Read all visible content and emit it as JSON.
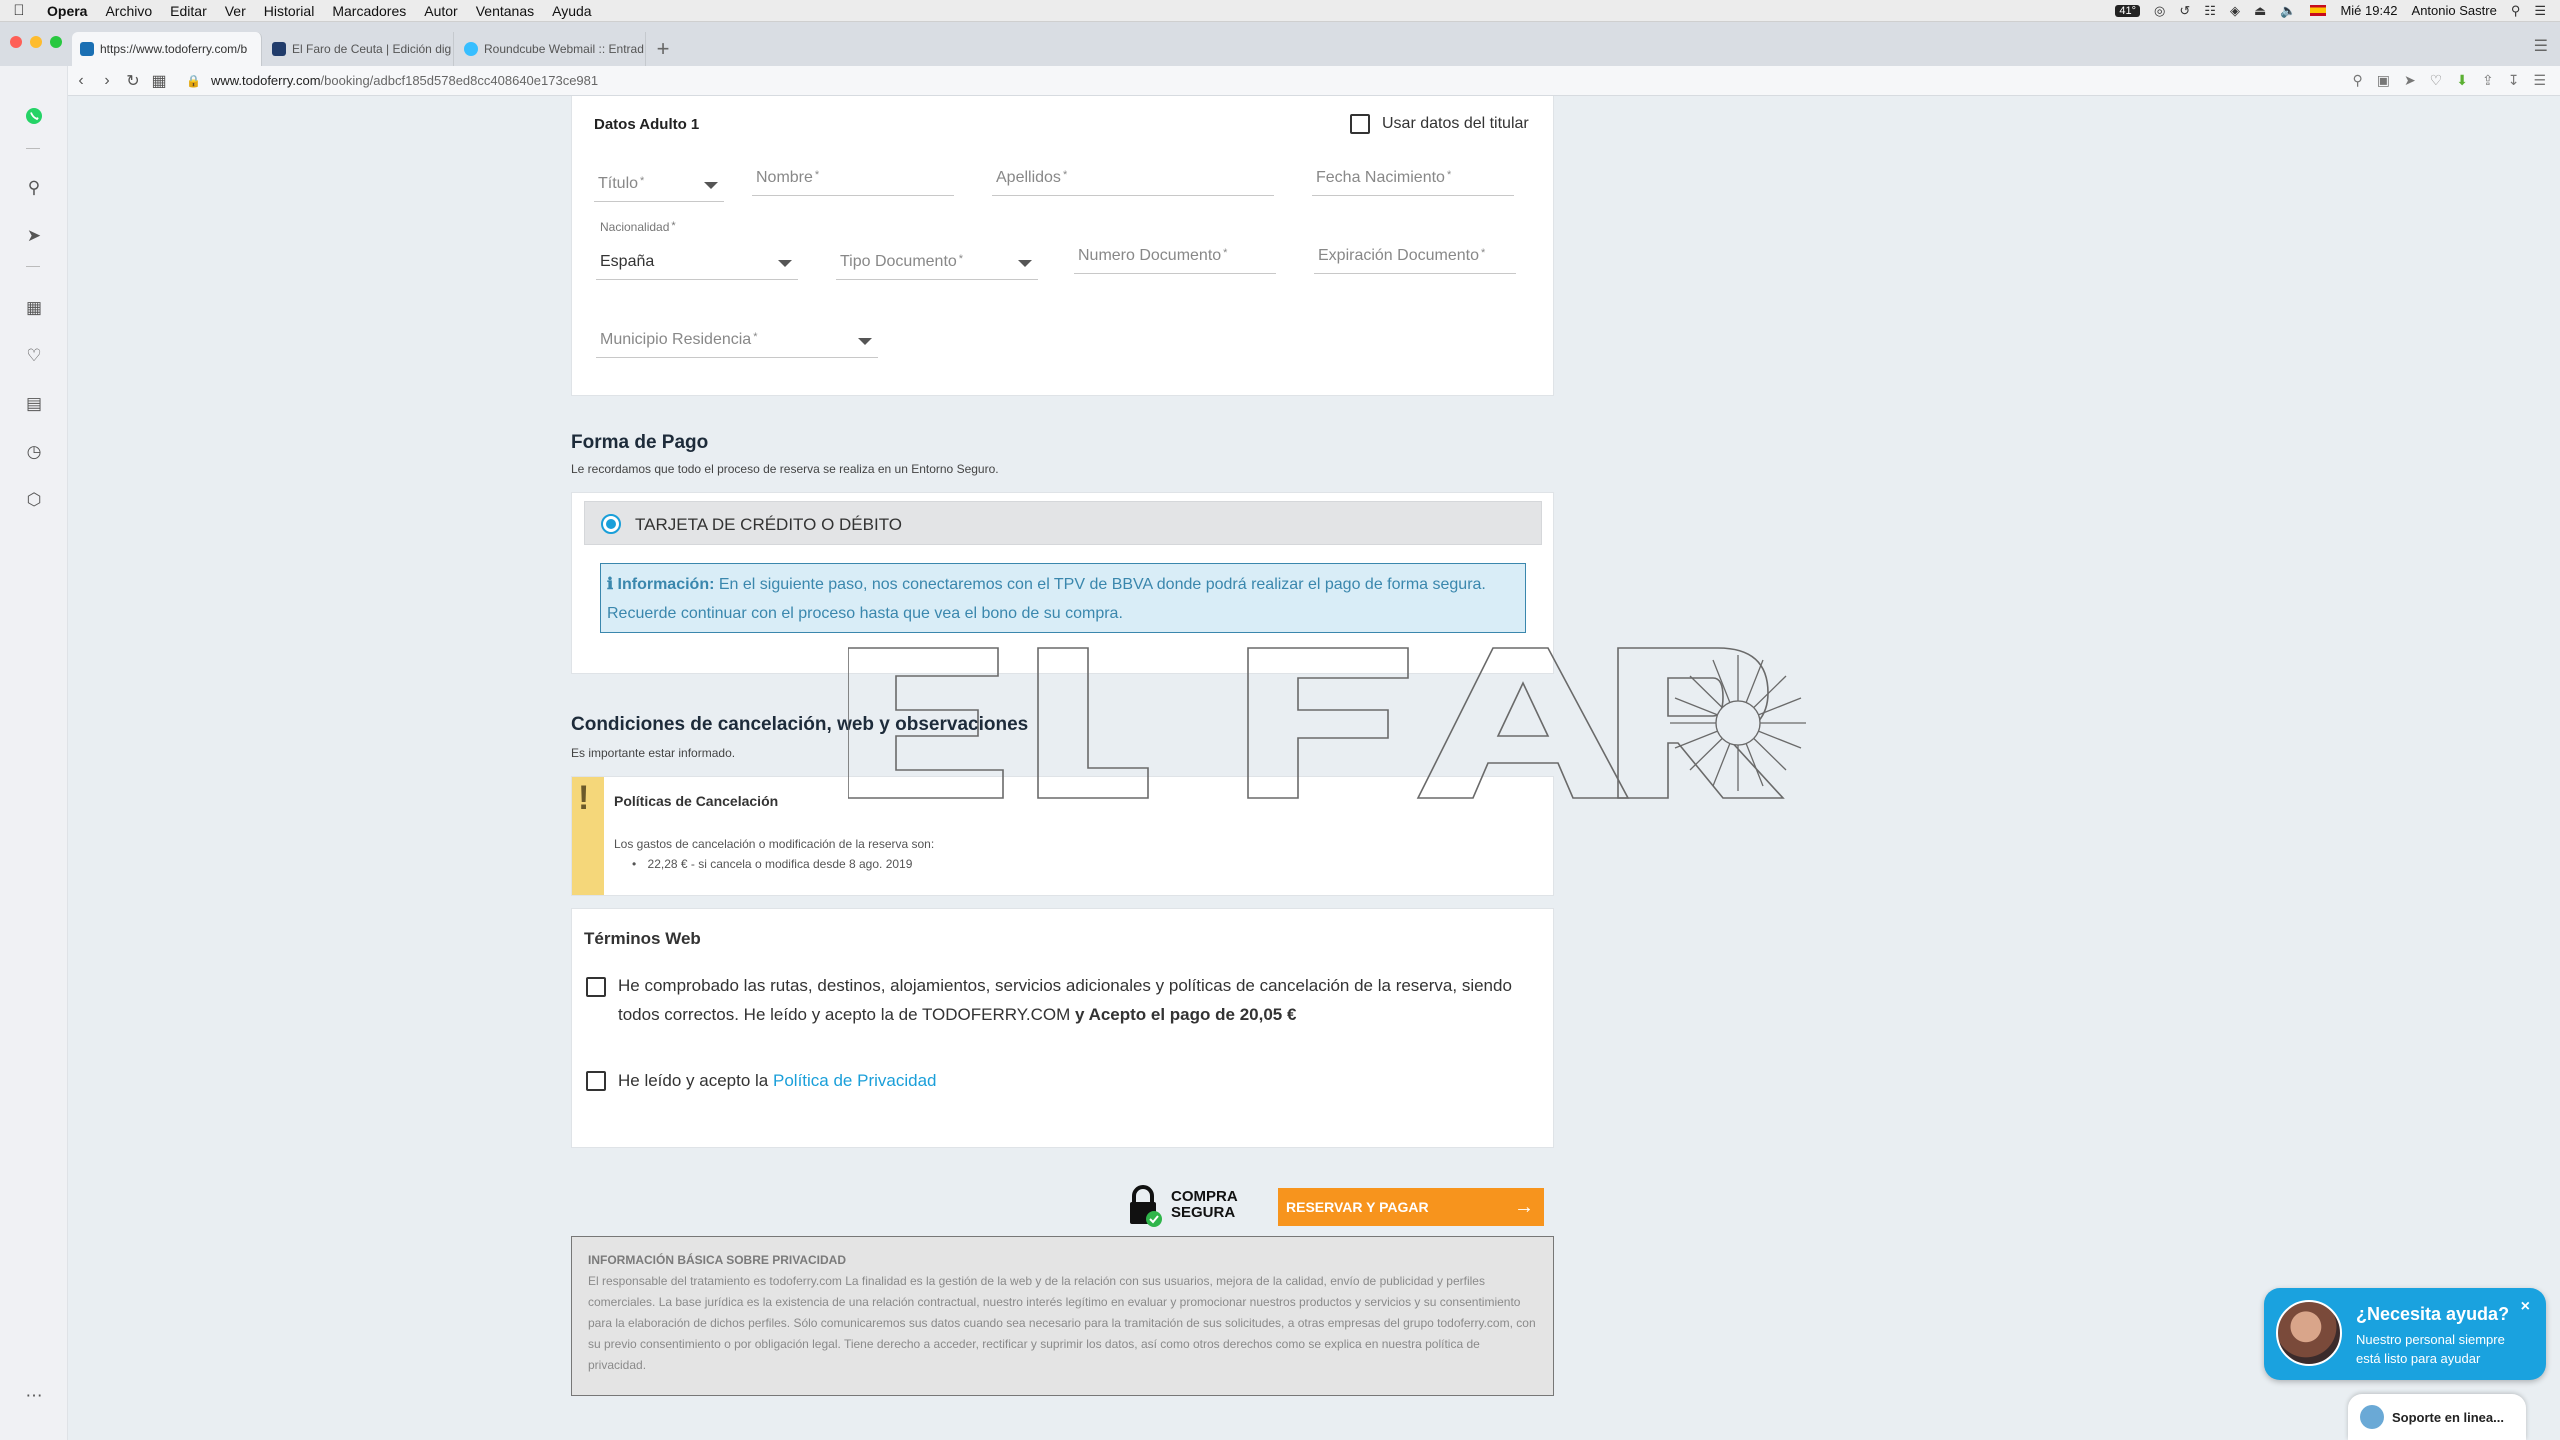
{
  "menubar": {
    "app": "Opera",
    "items": [
      "Archivo",
      "Editar",
      "Ver",
      "Historial",
      "Marcadores",
      "Autor",
      "Ventanas",
      "Ayuda"
    ],
    "temp_badge": "41°",
    "clock": "Mié 19:42",
    "user": "Antonio Sastre"
  },
  "tabs": [
    {
      "label": "https://www.todoferry.com/b",
      "active": true
    },
    {
      "label": "El Faro de Ceuta | Edición dig",
      "active": false
    },
    {
      "label": "Roundcube Webmail :: Entrad",
      "active": false
    }
  ],
  "address": {
    "url_domain": "www.todoferry.com",
    "url_path": "/booking/adbcf185d578ed8cc408640e173ce981"
  },
  "adult": {
    "heading": "Datos Adulto 1",
    "use_holder_label": "Usar datos del titular",
    "titulo": "Título",
    "nombre": "Nombre",
    "apellidos": "Apellidos",
    "fecha_nacimiento": "Fecha Nacimiento",
    "nacionalidad_label": "Nacionalidad",
    "nacionalidad_value": "España",
    "tipo_documento": "Tipo Documento",
    "numero_documento": "Numero Documento",
    "expiracion_documento": "Expiración Documento",
    "municipio": "Municipio Residencia",
    "required_mark": "*"
  },
  "payment": {
    "heading": "Forma de Pago",
    "subtitle": "Le recordamos que todo el proceso de reserva se realiza en un Entorno Seguro.",
    "option": "TARJETA DE CRÉDITO O DÉBITO",
    "info_label": "Información:",
    "info_text": "En el siguiente paso, nos conectaremos con el TPV de BBVA donde podrá realizar el pago de forma segura. Recuerde continuar con el proceso hasta que vea el bono de su compra."
  },
  "cancellation": {
    "heading": "Condiciones de cancelación, web y observaciones",
    "subtitle": "Es importante estar informado.",
    "policy_title": "Políticas de Cancelación",
    "policy_text": "Los gastos de cancelación o modificación de la reserva son:",
    "policy_item": "22,28 € - si cancela o modifica desde 8 ago. 2019"
  },
  "terms": {
    "heading": "Términos Web",
    "check1_text": "He comprobado las rutas, destinos, alojamientos, servicios adicionales y políticas de cancelación de la reserva, siendo todos correctos. He leído y acepto la de TODOFERRY.COM",
    "check1_bold": "y Acepto el pago de 20,05 €",
    "check2_text": "He leído y acepto la",
    "check2_link": "Política de Privacidad"
  },
  "checkout": {
    "secure_line1": "COMPRA",
    "secure_line2": "SEGURA",
    "button": "RESERVAR Y PAGAR"
  },
  "privacy": {
    "title": "INFORMACIÓN BÁSICA SOBRE PRIVACIDAD",
    "text": "El responsable del tratamiento es todoferry.com La finalidad es la gestión de la web y de la relación con sus usuarios, mejora de la calidad, envío de publicidad y perfiles comerciales. La base jurídica es la existencia de una relación contractual, nuestro interés legítimo en evaluar y promocionar nuestros productos y servicios y su consentimiento para la elaboración de dichos perfiles. Sólo comunicaremos sus datos cuando sea necesario para la tramitación de sus solicitudes, a otras empresas del grupo todoferry.com, con su previo consentimiento o por obligación legal. Tiene derecho a acceder, rectificar y suprimir los datos, así como otros derechos como se explica en nuestra política de privacidad."
  },
  "help": {
    "title": "¿Necesita ayuda?",
    "text": "Nuestro personal siempre está listo para ayudar",
    "close": "×",
    "support": "Soporte en linea..."
  },
  "watermark": "EL FARO",
  "colors": {
    "accent_orange": "#f7941d",
    "info_blue": "#3a87ad",
    "link_blue": "#1a9fd9",
    "help_blue": "#1aa2df"
  },
  "icons": {
    "sidebar": [
      "whatsapp-icon",
      "search-icon",
      "send-icon",
      "speed-dial-icon",
      "heart-icon",
      "news-icon",
      "history-icon",
      "box-icon",
      "more-icon"
    ]
  }
}
